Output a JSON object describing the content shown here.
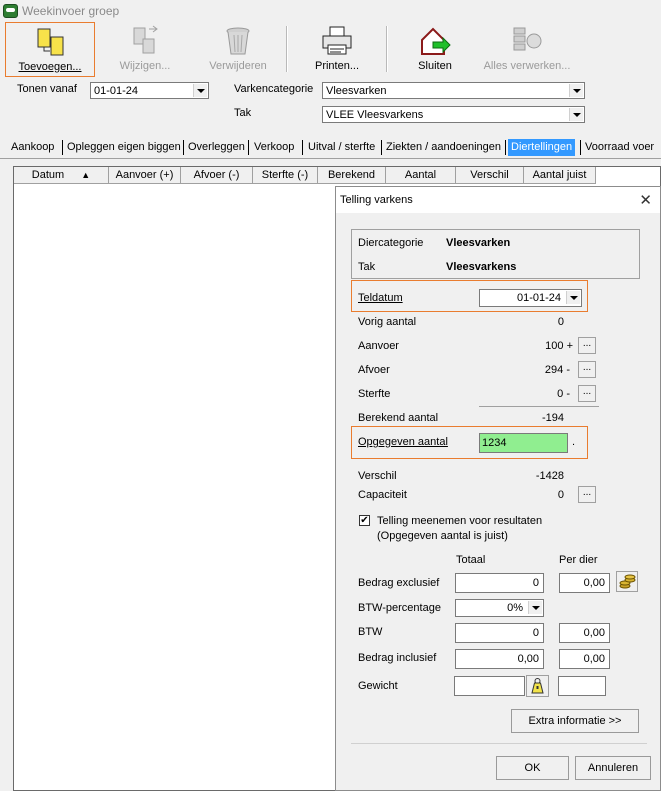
{
  "window": {
    "title": "Weekinvoer groep"
  },
  "toolbar": {
    "buttons": [
      {
        "label": "Toevoegen...",
        "accel": "T",
        "icon": "add-documents-icon",
        "enabled": true
      },
      {
        "label": "Wijzigen...",
        "accel": "W",
        "icon": "edit-documents-icon",
        "enabled": false
      },
      {
        "label": "Verwijderen",
        "accel": "V",
        "icon": "trash-can-icon",
        "enabled": false
      },
      {
        "label": "Printen...",
        "accel": "P",
        "icon": "printer-icon",
        "enabled": true
      },
      {
        "label": "Sluiten",
        "accel": "S",
        "icon": "exit-house-icon",
        "enabled": true
      },
      {
        "label": "Alles verwerken...",
        "accel": "A",
        "icon": "process-all-icon",
        "enabled": false
      }
    ]
  },
  "filters": {
    "tonen_vanaf_label": "Tonen vanaf",
    "tonen_vanaf_value": "01-01-24",
    "varkencategorie_label": "Varkencategorie",
    "varkencategorie_value": "Vleesvarken",
    "tak_label": "Tak",
    "tak_value": "VLEE  Vleesvarkens"
  },
  "tabs": [
    {
      "label": "Aankoop",
      "active": false
    },
    {
      "label": "Opleggen eigen biggen",
      "active": false
    },
    {
      "label": "Overleggen",
      "active": false
    },
    {
      "label": "Verkoop",
      "active": false
    },
    {
      "label": "Uitval / sterfte",
      "active": false
    },
    {
      "label": "Ziekten / aandoeningen",
      "active": false
    },
    {
      "label": "Diertellingen",
      "active": true
    },
    {
      "label": "Voorraad voer",
      "active": false
    }
  ],
  "grid": {
    "columns": [
      "Datum",
      "Aanvoer (+)",
      "Afvoer (-)",
      "Sterfte (-)",
      "Berekend",
      "Aantal",
      "Verschil",
      "Aantal juist"
    ],
    "sort_indicator": "▲"
  },
  "dialog": {
    "title": "Telling varkens",
    "diercategorie_label": "Diercategorie",
    "diercategorie_value": "Vleesvarken",
    "tak_label": "Tak",
    "tak_value": "Vleesvarkens",
    "teldatum_label": "Teldatum",
    "teldatum_value": "01-01-24",
    "vorig_aantal_label": "Vorig aantal",
    "vorig_aantal_value": "0",
    "aanvoer_label": "Aanvoer",
    "aanvoer_value": "100 +",
    "afvoer_label": "Afvoer",
    "afvoer_value": "294 -",
    "sterfte_label": "Sterfte",
    "sterfte_value": "0 -",
    "berekend_label": "Berekend aantal",
    "berekend_value": "-194",
    "opgegeven_label": "Opgegeven aantal",
    "opgegeven_value": "1234",
    "opgegeven_suffix": ".",
    "verschil_label": "Verschil",
    "verschil_value": "-1428",
    "capaciteit_label": "Capaciteit",
    "capaciteit_value": "0",
    "checkbox_line1": "Telling meenemen voor resultaten",
    "checkbox_line2": "(Opgegeven aantal is juist)",
    "checkbox_checked": true,
    "col_totaal": "Totaal",
    "col_per_dier": "Per dier",
    "bedrag_excl_label": "Bedrag exclusief",
    "bedrag_excl_totaal": "0",
    "bedrag_excl_per_dier": "0,00",
    "btw_pct_label": "BTW-percentage",
    "btw_pct_value": "0%",
    "btw_label": "BTW",
    "btw_totaal": "0",
    "btw_per_dier": "0,00",
    "bedrag_incl_label": "Bedrag inclusief",
    "bedrag_incl_totaal": "0,00",
    "bedrag_incl_per_dier": "0,00",
    "gewicht_label": "Gewicht",
    "extra_info_label": "Extra informatie >>",
    "ok_label": "OK",
    "cancel_label": "Annuleren",
    "dots_label": "..."
  }
}
